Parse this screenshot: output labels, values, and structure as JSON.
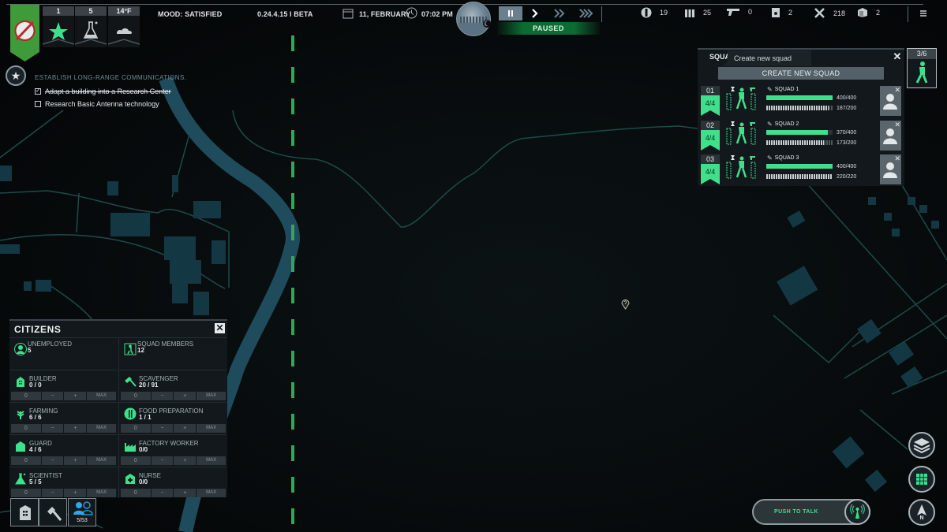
{
  "topbar": {
    "stats": [
      {
        "value": "1",
        "icon": "star-icon"
      },
      {
        "value": "5",
        "icon": "flask-icon"
      },
      {
        "value": "14°F",
        "icon": "cloud-icon"
      }
    ],
    "mood": "MOOD: SATISFIED",
    "version": "0.24.4.15 I BETA",
    "date": "11, FEBRUARY",
    "time": "07:02 PM",
    "speed_status": "PAUSED",
    "resources": [
      {
        "icon": "food-icon",
        "value": "19"
      },
      {
        "icon": "ammo-icon",
        "value": "25"
      },
      {
        "icon": "pistol-icon",
        "value": "0"
      },
      {
        "icon": "fuel-icon",
        "value": "2"
      },
      {
        "icon": "tools-icon",
        "value": "218"
      },
      {
        "icon": "crate-icon",
        "value": "2"
      }
    ]
  },
  "objective": {
    "title": "ESTABLISH LONG-RANGE COMMUNICATIONS.",
    "tasks": [
      {
        "label": "Adapt a building into a Research Center",
        "done": true
      },
      {
        "label": "Research Basic Antenna technology",
        "done": false
      }
    ]
  },
  "citizens": {
    "title": "CITIZENS",
    "summary": [
      {
        "label": "UNEMPLOYED",
        "count": "5"
      },
      {
        "label": "SQUAD MEMBERS",
        "count": "12"
      }
    ],
    "jobs": [
      {
        "label": "BUILDER",
        "count": "0 / 0",
        "assign": "0"
      },
      {
        "label": "SCAVENGER",
        "count": "20 / 91",
        "assign": "0"
      },
      {
        "label": "FARMING",
        "count": "6 / 6",
        "assign": "0"
      },
      {
        "label": "FOOD PREPARATION",
        "count": "1 / 1",
        "assign": "0"
      },
      {
        "label": "GUARD",
        "count": "4 / 6",
        "assign": "0"
      },
      {
        "label": "FACTORY WORKER",
        "count": "0/0",
        "assign": "0"
      },
      {
        "label": "SCIENTIST",
        "count": "5 / 5",
        "assign": "0"
      },
      {
        "label": "NURSE",
        "count": "0/0",
        "assign": "0"
      }
    ],
    "controls": {
      "minus": "−",
      "plus": "+",
      "max": "MAX"
    }
  },
  "bottom_tabs": [
    {
      "icon": "building-icon",
      "label": ""
    },
    {
      "icon": "axe-icon",
      "label": ""
    },
    {
      "icon": "citizens-icon",
      "label": "5/53"
    }
  ],
  "squads": {
    "title": "SQUA",
    "tooltip": "Create new squad",
    "create_label": "CREATE NEW SQUAD",
    "count": "3/6",
    "rows": [
      {
        "num": "01",
        "members": "4/4",
        "name": "SQUAD 1",
        "health": "400/400",
        "health_pct": 100,
        "supply": "187/200",
        "supply_pct": 93.5
      },
      {
        "num": "02",
        "members": "4/4",
        "name": "SQUAD 2",
        "health": "370/400",
        "health_pct": 92.5,
        "supply": "173/200",
        "supply_pct": 86.5
      },
      {
        "num": "03",
        "members": "4/4",
        "name": "SQUAD 3",
        "health": "400/400",
        "health_pct": 100,
        "supply": "220/220",
        "supply_pct": 100
      }
    ]
  },
  "map_controls": {
    "push_to_talk": "PUSH TO TALK",
    "compass_label": "N"
  },
  "colors": {
    "accent_green": "#3fe08c",
    "emblem_green": "#3f9a3a",
    "river": "#1f4c5c",
    "road": "#1d4a4a"
  }
}
